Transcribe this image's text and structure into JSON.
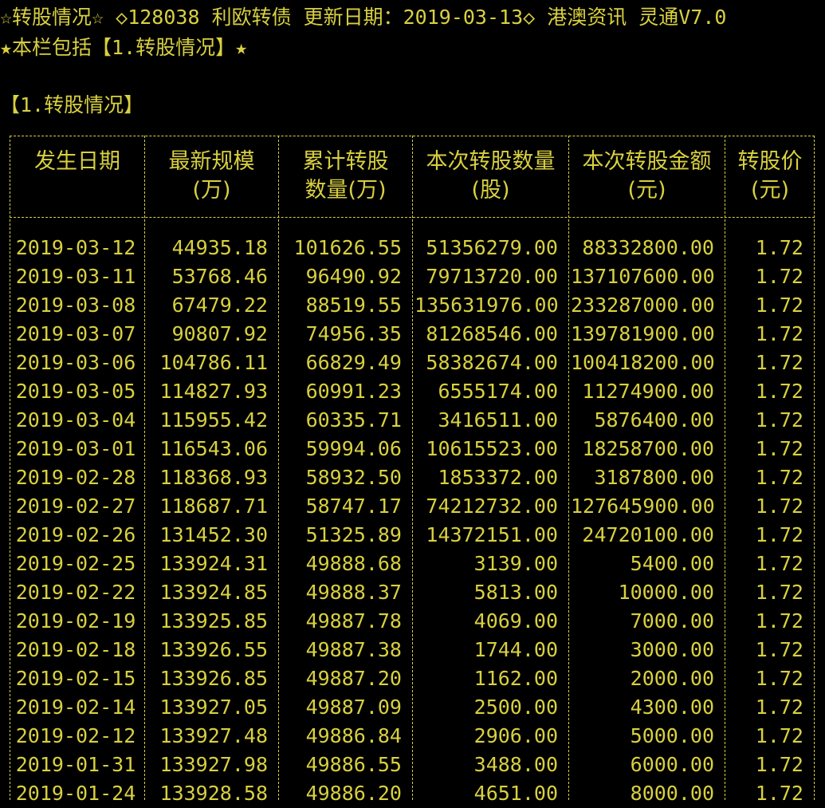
{
  "header": {
    "title": "☆转股情况☆ ◇128038 利欧转债 更新日期：2019-03-13◇ 港澳资讯 灵通V7.0",
    "subtitle": "★本栏包括【1.转股情况】★"
  },
  "section": {
    "title": "【1.转股情况】"
  },
  "table": {
    "columns": [
      {
        "line1": "发生日期",
        "line2": ""
      },
      {
        "line1": "最新规模",
        "line2": "(万)"
      },
      {
        "line1": "累计转股",
        "line2": "数量(万)"
      },
      {
        "line1": "本次转股数量",
        "line2": "(股)"
      },
      {
        "line1": "本次转股金额",
        "line2": "(元)"
      },
      {
        "line1": "转股价",
        "line2": "(元)"
      }
    ],
    "rows": [
      [
        "2019-03-12",
        "44935.18",
        "101626.55",
        "51356279.00",
        "88332800.00",
        "1.72"
      ],
      [
        "2019-03-11",
        "53768.46",
        "96490.92",
        "79713720.00",
        "137107600.00",
        "1.72"
      ],
      [
        "2019-03-08",
        "67479.22",
        "88519.55",
        "135631976.00",
        "233287000.00",
        "1.72"
      ],
      [
        "2019-03-07",
        "90807.92",
        "74956.35",
        "81268546.00",
        "139781900.00",
        "1.72"
      ],
      [
        "2019-03-06",
        "104786.11",
        "66829.49",
        "58382674.00",
        "100418200.00",
        "1.72"
      ],
      [
        "2019-03-05",
        "114827.93",
        "60991.23",
        "6555174.00",
        "11274900.00",
        "1.72"
      ],
      [
        "2019-03-04",
        "115955.42",
        "60335.71",
        "3416511.00",
        "5876400.00",
        "1.72"
      ],
      [
        "2019-03-01",
        "116543.06",
        "59994.06",
        "10615523.00",
        "18258700.00",
        "1.72"
      ],
      [
        "2019-02-28",
        "118368.93",
        "58932.50",
        "1853372.00",
        "3187800.00",
        "1.72"
      ],
      [
        "2019-02-27",
        "118687.71",
        "58747.17",
        "74212732.00",
        "127645900.00",
        "1.72"
      ],
      [
        "2019-02-26",
        "131452.30",
        "51325.89",
        "14372151.00",
        "24720100.00",
        "1.72"
      ],
      [
        "2019-02-25",
        "133924.31",
        "49888.68",
        "3139.00",
        "5400.00",
        "1.72"
      ],
      [
        "2019-02-22",
        "133924.85",
        "49888.37",
        "5813.00",
        "10000.00",
        "1.72"
      ],
      [
        "2019-02-19",
        "133925.85",
        "49887.78",
        "4069.00",
        "7000.00",
        "1.72"
      ],
      [
        "2019-02-18",
        "133926.55",
        "49887.38",
        "1744.00",
        "3000.00",
        "1.72"
      ],
      [
        "2019-02-15",
        "133926.85",
        "49887.20",
        "1162.00",
        "2000.00",
        "1.72"
      ],
      [
        "2019-02-14",
        "133927.05",
        "49887.09",
        "2500.00",
        "4300.00",
        "1.72"
      ],
      [
        "2019-02-12",
        "133927.48",
        "49886.84",
        "2906.00",
        "5000.00",
        "1.72"
      ],
      [
        "2019-01-31",
        "133927.98",
        "49886.55",
        "3488.00",
        "6000.00",
        "1.72"
      ],
      [
        "2019-01-24",
        "133928.58",
        "49886.20",
        "4651.00",
        "8000.00",
        "1.72"
      ]
    ]
  },
  "colors": {
    "text": "#d8d040",
    "background": "#000000"
  }
}
